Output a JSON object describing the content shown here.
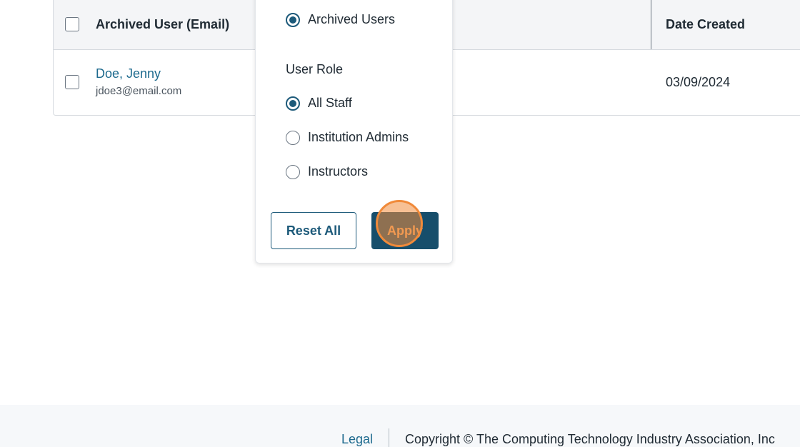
{
  "table": {
    "headers": {
      "user": "Archived User (Email)",
      "date_created": "Date Created"
    },
    "rows": [
      {
        "name": "Doe, Jenny",
        "email": "jdoe3@email.com",
        "date_created": "03/09/2024"
      }
    ]
  },
  "filter": {
    "status_option": "Archived Users",
    "user_role_label": "User Role",
    "role_options": [
      "All Staff",
      "Institution Admins",
      "Instructors"
    ],
    "selected_role": "All Staff",
    "reset_label": "Reset All",
    "apply_label": "Apply"
  },
  "footer": {
    "legal_link": "Legal",
    "copyright": "Copyright © The Computing Technology Industry Association, Inc"
  },
  "colors": {
    "accent": "#174e6b",
    "link": "#1d6a8e",
    "click_marker": "#f08a3a"
  }
}
